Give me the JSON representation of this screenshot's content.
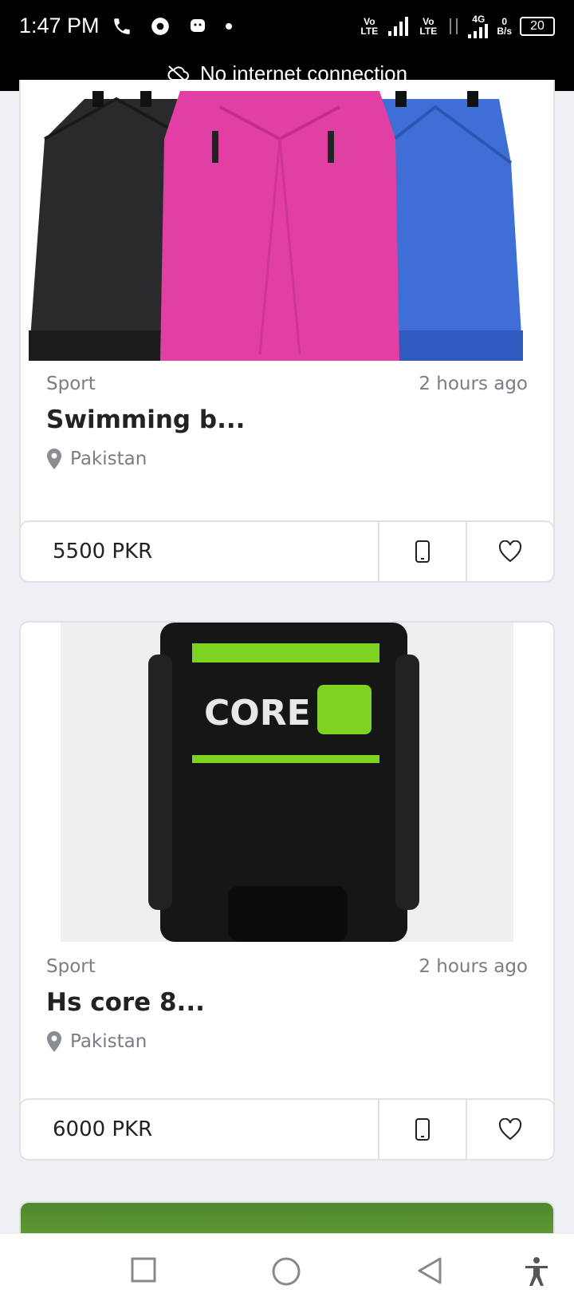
{
  "status_bar": {
    "time": "1:47 PM",
    "network1": "Vo LTE",
    "network2": "Vo LTE",
    "network3": "4G",
    "speed_value": "0",
    "speed_unit": "B/s",
    "battery": "20"
  },
  "banner": {
    "text": "No internet connection",
    "icon": "cloud-off-icon"
  },
  "listings": [
    {
      "category": "Sport",
      "time": "2 hours ago",
      "title": "Swimming b...",
      "location": "Pakistan",
      "price": "5500 PKR"
    },
    {
      "category": "Sport",
      "time": "2 hours ago",
      "title": "Hs core 8...",
      "location": "Pakistan",
      "price": "6000 PKR",
      "image_text": "CORE"
    }
  ],
  "icons": {
    "location": "location-pin-icon",
    "phone": "phone-icon",
    "favorite": "heart-icon"
  },
  "colors": {
    "accent_green": "#7ed321",
    "pink": "#e23fa4",
    "blue": "#3f6fd6"
  }
}
